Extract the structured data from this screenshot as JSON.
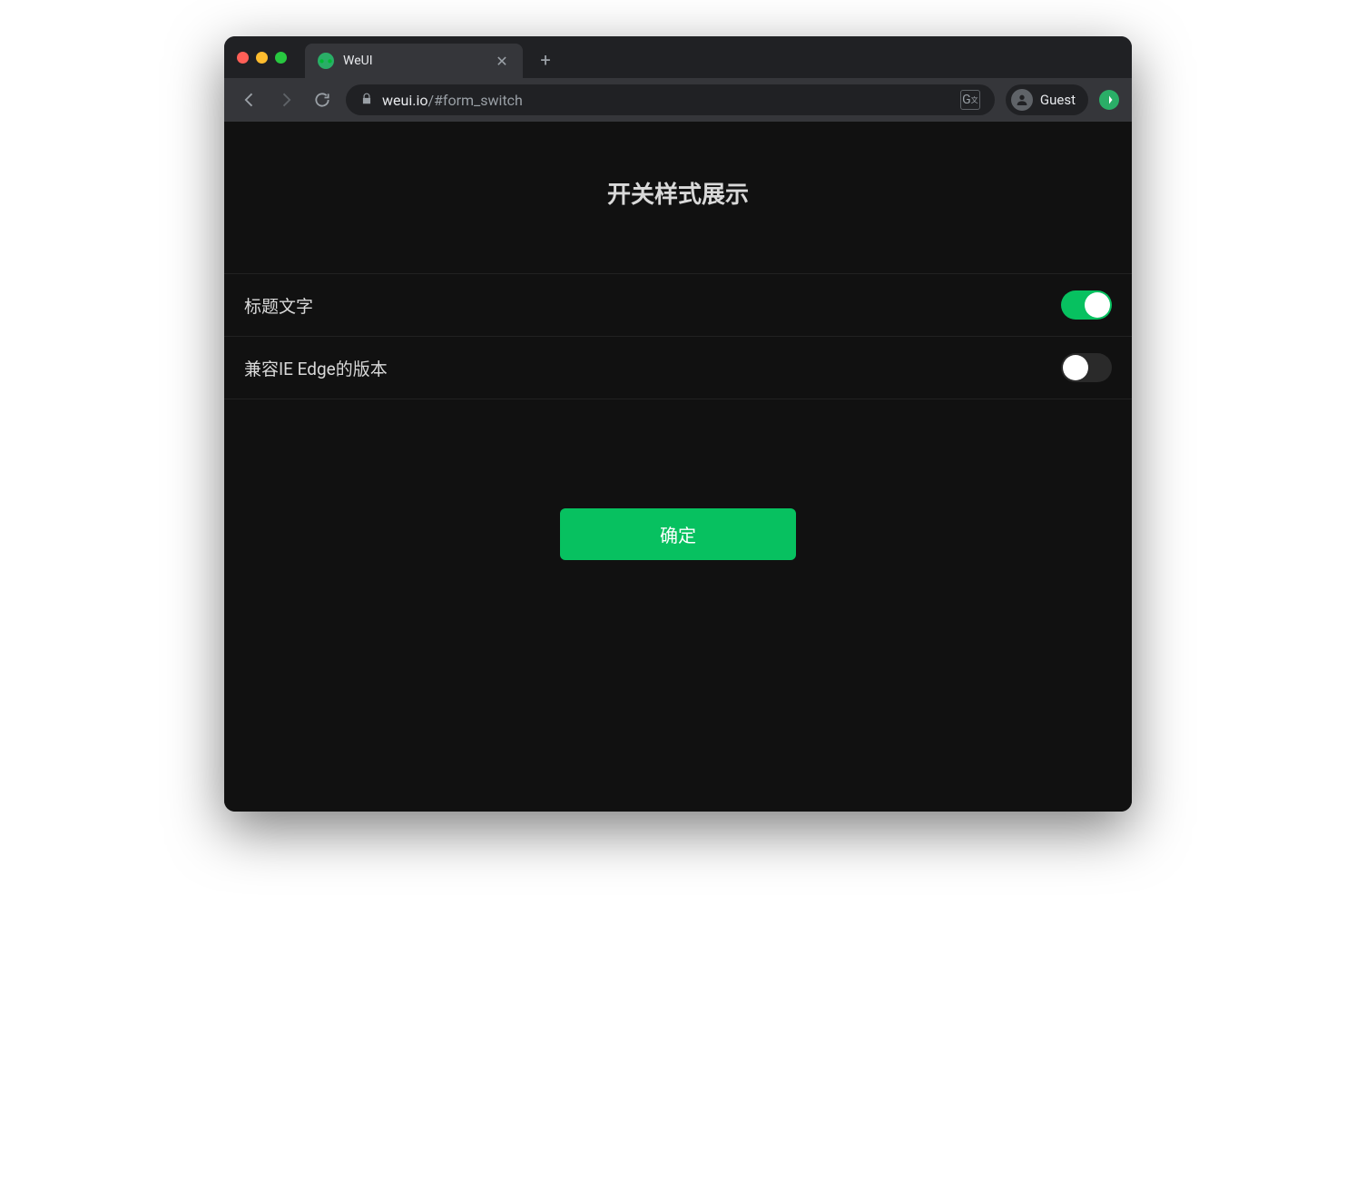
{
  "browser": {
    "tab": {
      "title": "WeUI",
      "favicon": "wechat-icon"
    },
    "url": {
      "domain": "weui.io",
      "path": "/#form_switch"
    },
    "guest_label": "Guest"
  },
  "page": {
    "title": "开关样式展示",
    "switches": [
      {
        "label": "标题文字",
        "on": true
      },
      {
        "label": "兼容IE Edge的版本",
        "on": false
      }
    ],
    "confirm_button": "确定"
  },
  "colors": {
    "accent": "#07c160",
    "bg_dark": "#111"
  }
}
